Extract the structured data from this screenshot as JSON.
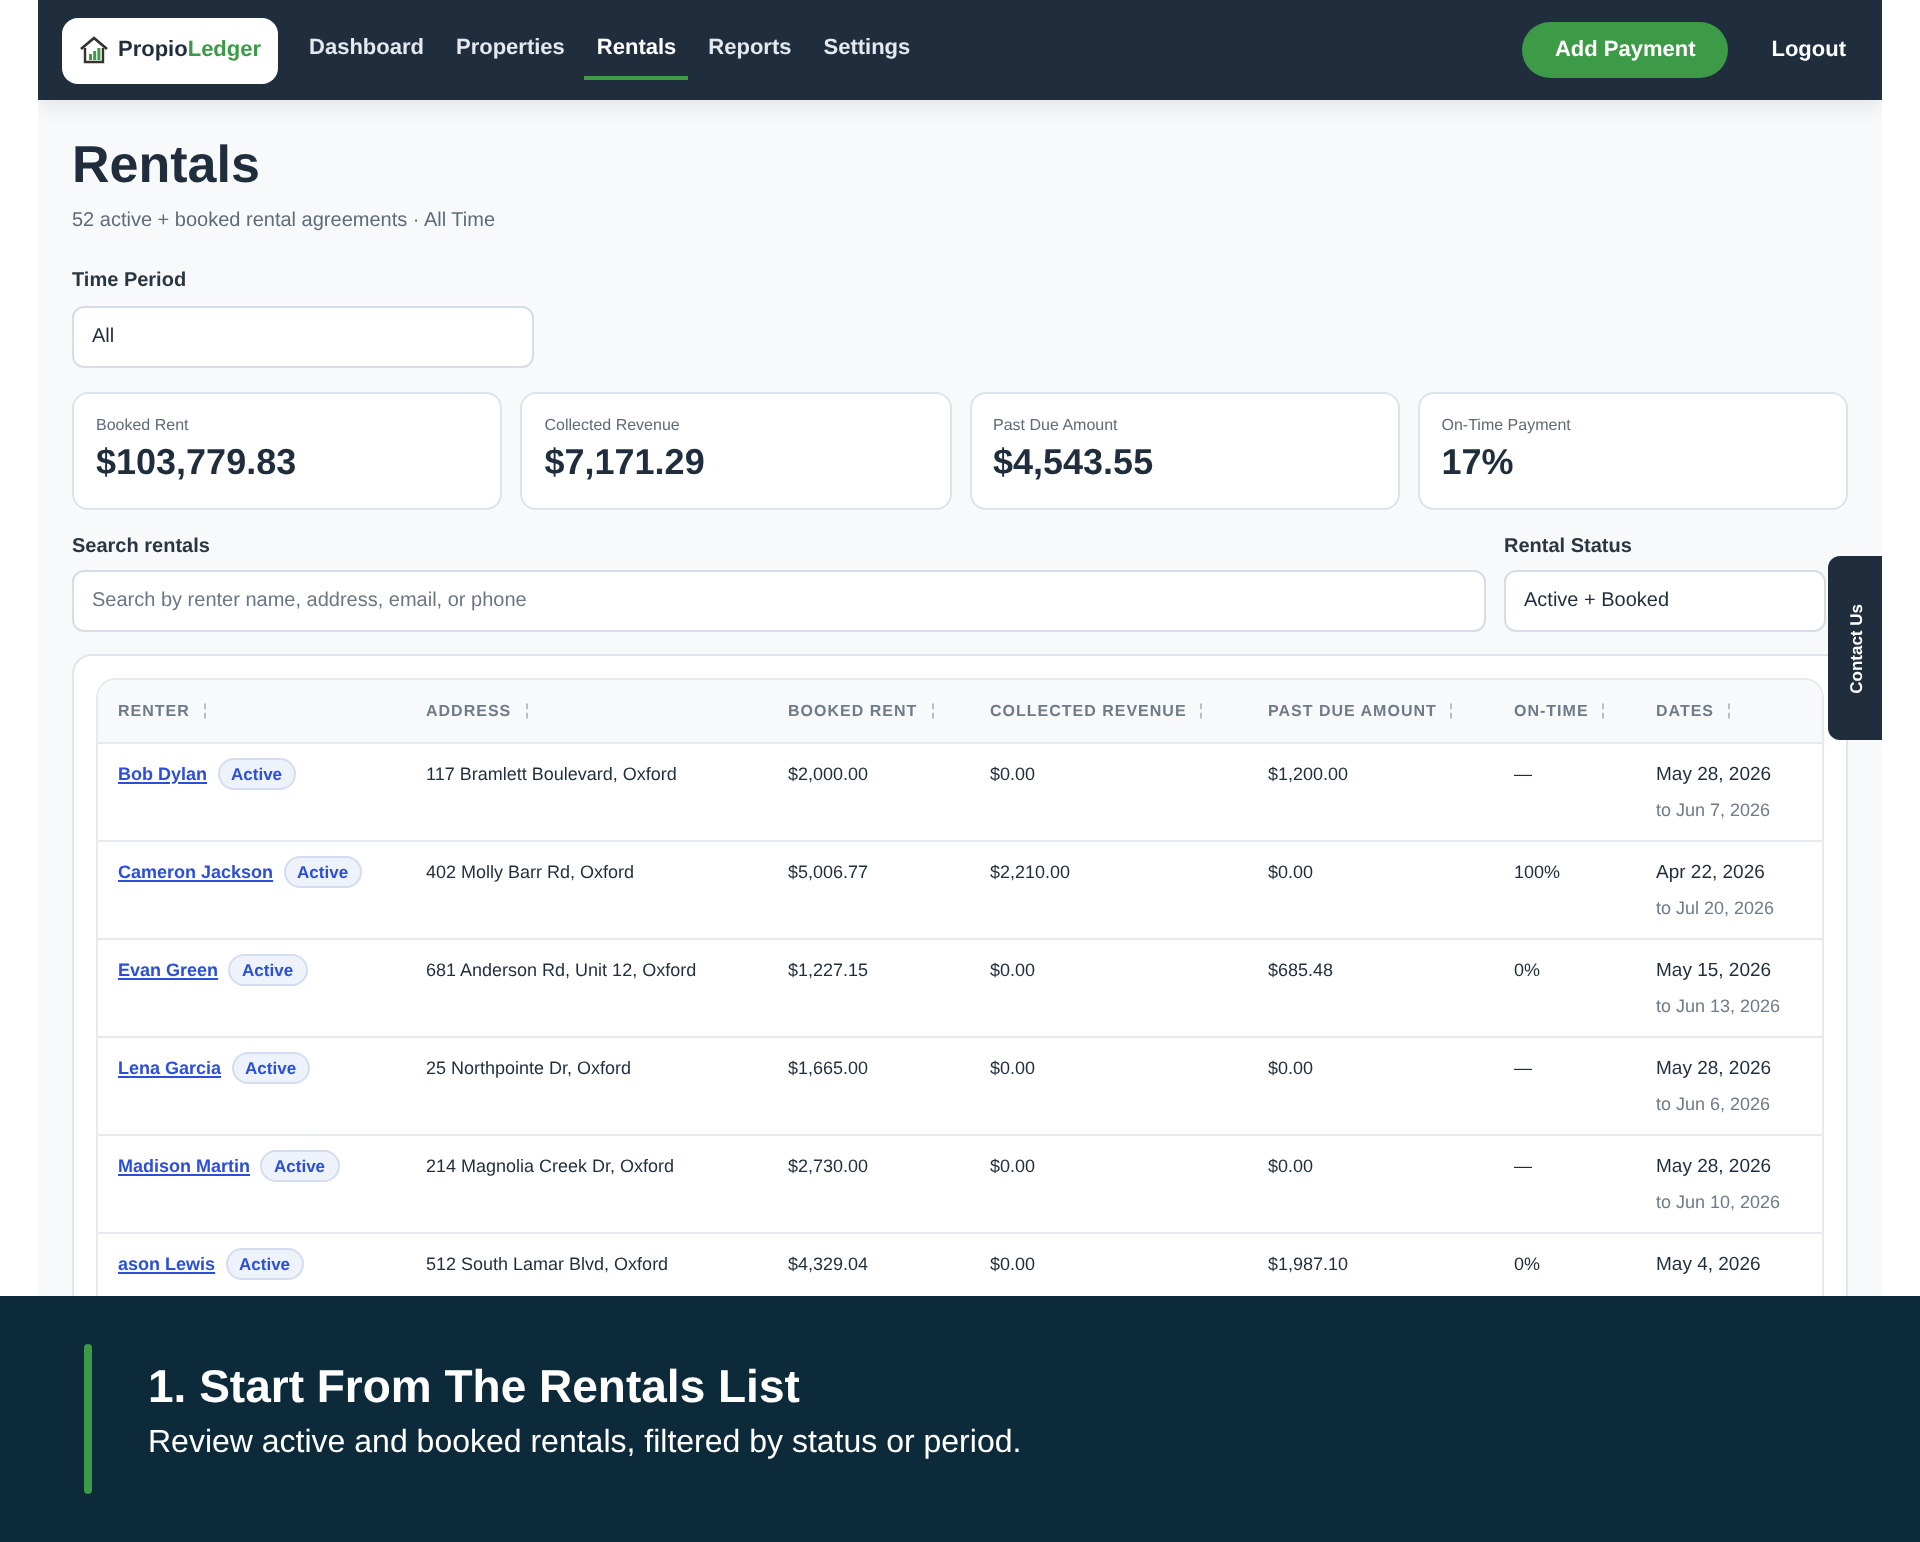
{
  "nav": {
    "logo": {
      "first": "Propio",
      "second": "Ledger"
    },
    "items": [
      {
        "label": "Dashboard",
        "selected": false
      },
      {
        "label": "Properties",
        "selected": false
      },
      {
        "label": "Rentals",
        "selected": true
      },
      {
        "label": "Reports",
        "selected": false
      },
      {
        "label": "Settings",
        "selected": false
      }
    ],
    "add_button": "Add Payment",
    "logout": "Logout"
  },
  "page": {
    "title": "Rentals",
    "subtitle": "52 active + booked rental agreements · All Time"
  },
  "time_period": {
    "label": "Time Period",
    "value": "All"
  },
  "stats": [
    {
      "label": "Booked Rent",
      "value": "$103,779.83"
    },
    {
      "label": "Collected Revenue",
      "value": "$7,171.29"
    },
    {
      "label": "Past Due Amount",
      "value": "$4,543.55"
    },
    {
      "label": "On-Time Payment",
      "value": "17%"
    }
  ],
  "search": {
    "label": "Search rentals",
    "placeholder": "Search by renter name, address, email, or phone"
  },
  "status_filter": {
    "label": "Rental Status",
    "value": "Active + Booked"
  },
  "contact_tab": "Contact Us",
  "table": {
    "columns": [
      "RENTER",
      "ADDRESS",
      "BOOKED RENT",
      "COLLECTED REVENUE",
      "PAST DUE AMOUNT",
      "ON-TIME",
      "DATES"
    ],
    "rows": [
      {
        "renter": "Bob Dylan",
        "status": "Active",
        "address": "117 Bramlett Boulevard, Oxford",
        "booked": "$2,000.00",
        "collected": "$0.00",
        "past_due": "$1,200.00",
        "on_time": "—",
        "start": "May 28, 2026",
        "end": "to Jun 7, 2026"
      },
      {
        "renter": "Cameron Jackson",
        "status": "Active",
        "address": "402 Molly Barr Rd, Oxford",
        "booked": "$5,006.77",
        "collected": "$2,210.00",
        "past_due": "$0.00",
        "on_time": "100%",
        "start": "Apr 22, 2026",
        "end": "to Jul 20, 2026"
      },
      {
        "renter": "Evan Green",
        "status": "Active",
        "address": "681 Anderson Rd, Unit 12, Oxford",
        "booked": "$1,227.15",
        "collected": "$0.00",
        "past_due": "$685.48",
        "on_time": "0%",
        "start": "May 15, 2026",
        "end": "to Jun 13, 2026"
      },
      {
        "renter": "Lena Garcia",
        "status": "Active",
        "address": "25 Northpointe Dr, Oxford",
        "booked": "$1,665.00",
        "collected": "$0.00",
        "past_due": "$0.00",
        "on_time": "—",
        "start": "May 28, 2026",
        "end": "to Jun 6, 2026"
      },
      {
        "renter": "Madison Martin",
        "status": "Active",
        "address": "214 Magnolia Creek Dr, Oxford",
        "booked": "$2,730.00",
        "collected": "$0.00",
        "past_due": "$0.00",
        "on_time": "—",
        "start": "May 28, 2026",
        "end": "to Jun 10, 2026"
      },
      {
        "renter": "ason Lewis",
        "status": "Active",
        "address": "512 South Lamar Blvd, Oxford",
        "booked": "$4,329.04",
        "collected": "$0.00",
        "past_due": "$1,987.10",
        "on_time": "0%",
        "start": "May 4, 2026"
      }
    ]
  },
  "caption": {
    "title": "1. Start From The Rentals List",
    "text": "Review active and booked rentals, filtered by status or period."
  }
}
